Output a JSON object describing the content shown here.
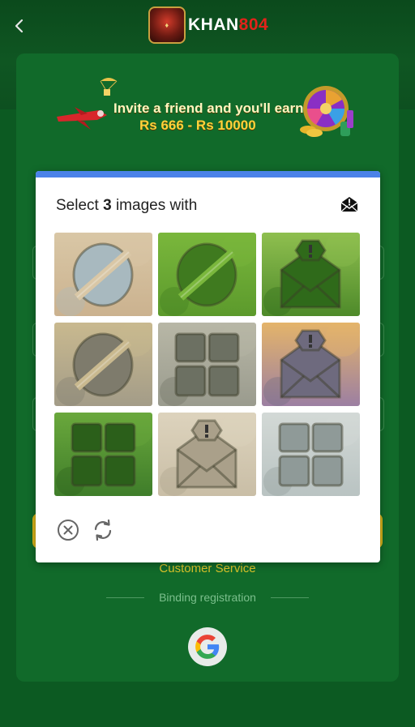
{
  "header": {
    "back_icon": "chevron-left-icon",
    "logo_white": "KHAN",
    "logo_red": "804",
    "brand_red": "#e2231a"
  },
  "banner": {
    "line1": "Invite a friend and you'll earn",
    "line2": "Rs 666 - Rs 10000"
  },
  "captcha": {
    "prompt_prefix": "Select ",
    "prompt_count": "3",
    "prompt_suffix": " images with",
    "target_icon": "mail-alert-icon",
    "accent": "#4b82e8",
    "tiles": [
      {
        "scene": "sand-river",
        "shape": "slashed-circle"
      },
      {
        "scene": "green-grass",
        "shape": "slashed-circle"
      },
      {
        "scene": "green-foliage",
        "shape": "mail-alert"
      },
      {
        "scene": "dry-ground",
        "shape": "slashed-circle"
      },
      {
        "scene": "mountain-windows",
        "shape": "four-windows"
      },
      {
        "scene": "sunset-field",
        "shape": "mail-alert"
      },
      {
        "scene": "green-garden",
        "shape": "four-windows"
      },
      {
        "scene": "beige-stone",
        "shape": "mail-alert"
      },
      {
        "scene": "grey-fog",
        "shape": "four-windows"
      }
    ],
    "close_icon": "close-circle-icon",
    "refresh_icon": "refresh-icon"
  },
  "footer": {
    "customer_service": "Customer Service",
    "binding_registration": "Binding registration",
    "google_icon": "google-icon"
  }
}
